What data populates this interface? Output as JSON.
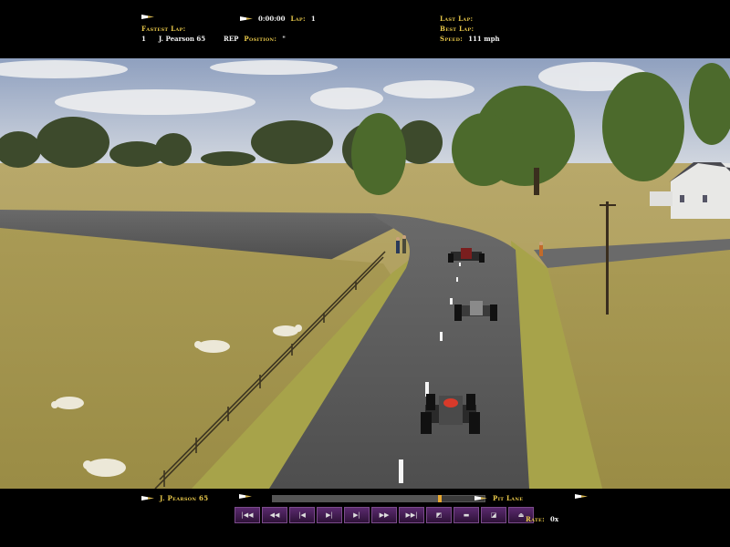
{
  "hud_top": {
    "fastest_lap_label": "Fastest Lap:",
    "timer": "0:00:00",
    "lap_label": "Lap:",
    "lap_value": "1",
    "driver_number": "1",
    "driver_name": "J. Pearson 65",
    "rep_label": "REP",
    "position_label": "Position:",
    "position_value": "\"",
    "last_lap_label": "Last Lap:",
    "best_lap_label": "Best Lap:",
    "speed_label": "Speed:",
    "speed_value": "111 mph"
  },
  "hud_bottom": {
    "driver_name": "J. Pearson 65",
    "pit_lane_label": "Pit Lane",
    "rate_label": "Rate:",
    "rate_value": "0x",
    "timeline_progress": 0.79,
    "controls": [
      {
        "name": "rewind-start-button",
        "glyph": "|◀◀"
      },
      {
        "name": "fast-rewind-button",
        "glyph": "◀◀"
      },
      {
        "name": "step-back-button",
        "glyph": "|◀"
      },
      {
        "name": "play-pause-button",
        "glyph": "▶|"
      },
      {
        "name": "step-forward-button",
        "glyph": "▶|"
      },
      {
        "name": "fast-forward-button",
        "glyph": "▶▶"
      },
      {
        "name": "forward-end-button",
        "glyph": "▶▶|"
      },
      {
        "name": "camera-button",
        "glyph": "◩"
      },
      {
        "name": "view-button",
        "glyph": "▬"
      },
      {
        "name": "record-button",
        "glyph": "◪"
      },
      {
        "name": "eject-button",
        "glyph": "⏏"
      }
    ]
  },
  "colors": {
    "hud_gold": "#e8c84a",
    "hud_text": "#f0f0f0",
    "button_purple": "#5a2a6e",
    "grass": "#a99a55",
    "road": "#5a5a5a",
    "sky": "#b7c3d6"
  }
}
